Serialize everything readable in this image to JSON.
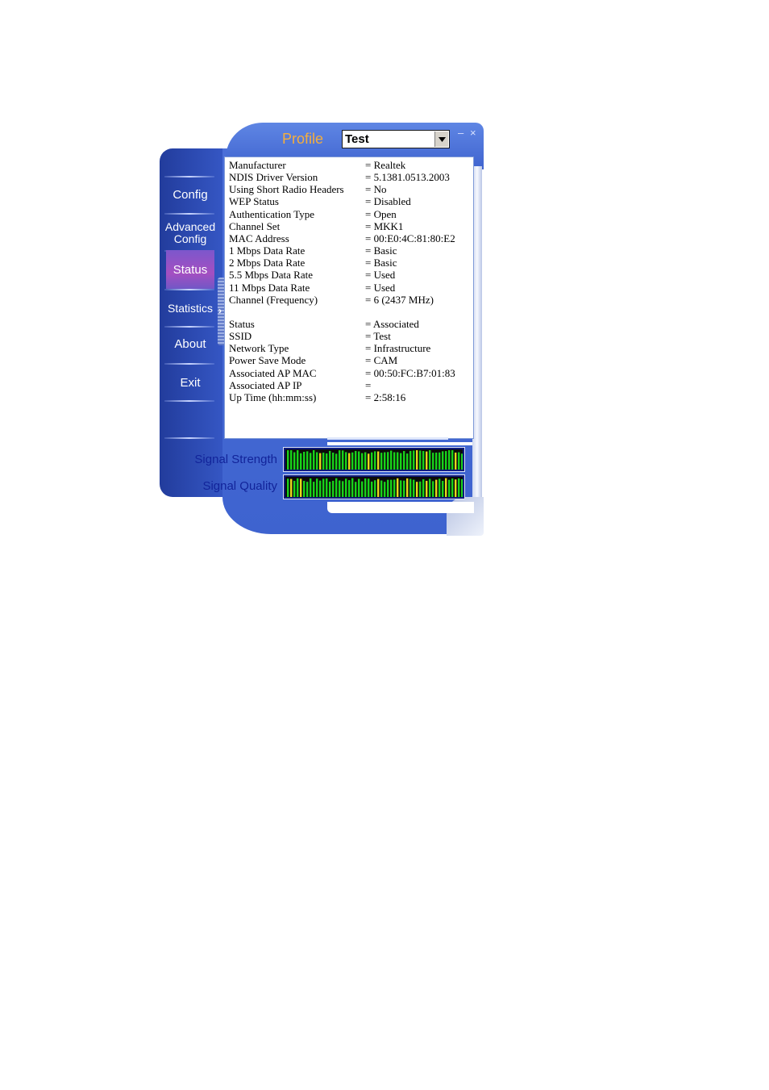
{
  "header": {
    "profile_label": "Profile",
    "profile_value": "Test",
    "minimize_label": "–",
    "close_label": "×"
  },
  "nav": {
    "items": [
      {
        "label": "Config"
      },
      {
        "label": "Advanced\nConfig"
      },
      {
        "label": "Status"
      },
      {
        "label": "Statistics"
      },
      {
        "label": "About"
      },
      {
        "label": "Exit"
      }
    ],
    "active": "Status"
  },
  "status": {
    "rows": [
      {
        "key": "Manufacturer",
        "value": "= Realtek"
      },
      {
        "key": "NDIS Driver Version",
        "value": "= 5.1381.0513.2003"
      },
      {
        "key": "Using Short Radio Headers",
        "value": "= No"
      },
      {
        "key": "WEP Status",
        "value": "= Disabled"
      },
      {
        "key": "Authentication Type",
        "value": "= Open"
      },
      {
        "key": "Channel Set",
        "value": "= MKK1"
      },
      {
        "key": "MAC Address",
        "value": "= 00:E0:4C:81:80:E2"
      },
      {
        "key": "1 Mbps Data Rate",
        "value": "= Basic"
      },
      {
        "key": "2 Mbps Data Rate",
        "value": "= Basic"
      },
      {
        "key": "5.5 Mbps Data Rate",
        "value": "= Used"
      },
      {
        "key": "11 Mbps Data Rate",
        "value": "= Used"
      },
      {
        "key": "Channel (Frequency)",
        "value": "= 6 (2437 MHz)"
      },
      {
        "key": "",
        "value": ""
      },
      {
        "key": "Status",
        "value": "= Associated"
      },
      {
        "key": "SSID",
        "value": "= Test"
      },
      {
        "key": "Network Type",
        "value": "= Infrastructure"
      },
      {
        "key": "Power Save Mode",
        "value": "= CAM"
      },
      {
        "key": "Associated AP MAC",
        "value": "= 00:50:FC:B7:01:83"
      },
      {
        "key": "Associated AP IP",
        "value": "="
      },
      {
        "key": "Up Time (hh:mm:ss)",
        "value": "= 2:58:16"
      }
    ]
  },
  "meters": {
    "signal_strength_label": "Signal Strength",
    "signal_quality_label": "Signal Quality",
    "signal_strength_level": 0.9,
    "signal_quality_level": 0.86
  },
  "colors": {
    "accent_profile": "#f5ae3c",
    "meter_green": "#18d21a",
    "meter_yellow": "#e6d81c",
    "meter_label": "#12249a"
  },
  "icons": {
    "dropdown": "chevron-down-icon",
    "minimize": "minimize-icon",
    "close": "close-icon",
    "collapse": "chevron-right-icon"
  }
}
